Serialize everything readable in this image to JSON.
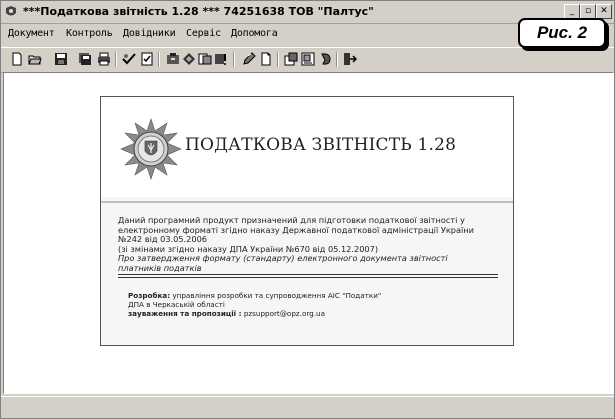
{
  "window": {
    "title": "***Податкова звітність 1.28 *** 74251638 ТОВ \"Палтус\""
  },
  "figure_label": "Рис. 2",
  "menu": {
    "items": [
      "Документ",
      "Контроль",
      "Довідники",
      "Сервіс",
      "Допомога"
    ]
  },
  "toolbar": {
    "icons": [
      "new-document-icon",
      "open-folder-icon",
      "save-icon",
      "save-all-icon",
      "print-icon",
      "verify-icon",
      "check-icon",
      "archive-icon",
      "export-icon",
      "import-icon",
      "send-icon",
      "edit-icon",
      "document-icon",
      "settings-icon",
      "catalog-icon",
      "help-icon",
      "exit-icon"
    ]
  },
  "splash": {
    "product_title": "ПОДАТКОВА ЗВІТНІСТЬ 1.28",
    "description_line1": "Даний програмний продукт призначений для підготовки податкової звітності у",
    "description_line2": "електронному форматі згідно наказу Державної податкової адміністрації України",
    "description_line3": "№242 від 03.05.2006",
    "description_line4": "(зі змінами згідно наказу ДПА України №670 від 05.12.2007)",
    "description_italic1": "Про затвердження формату (стандарту) електронного документа звітності",
    "description_italic2": "платників податків",
    "credit_label": "Розробка:",
    "credit_text1": "управління розробки та супроводження АІС \"Податки\"",
    "credit_text2": "ДПА в Черкаській області",
    "feedback_label": "зауваження та пропозиції :",
    "feedback_email": "pzsupport@opz.org.ua"
  },
  "colors": {
    "window_bg": "#d4d0c8",
    "client_bg": "#ffffff",
    "splash_bg": "#f6f6f6"
  }
}
